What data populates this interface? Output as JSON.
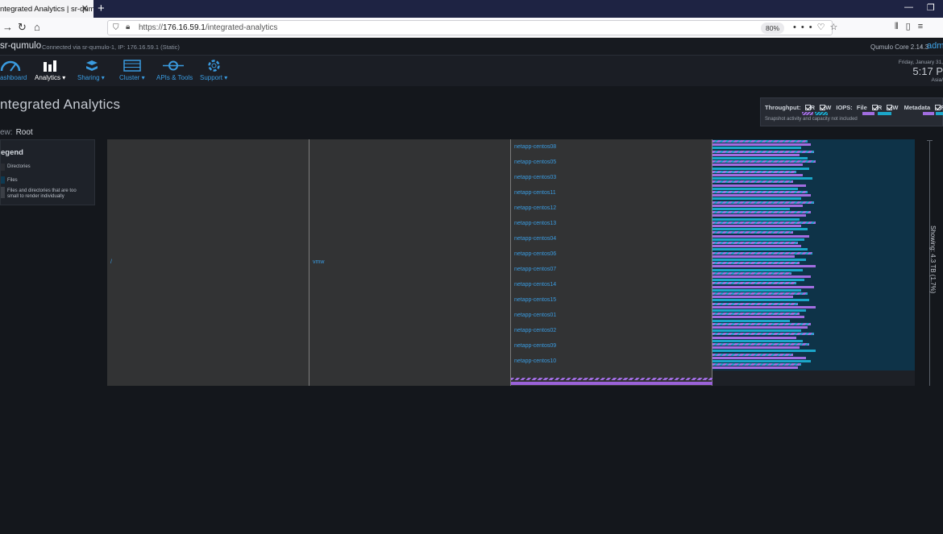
{
  "browser": {
    "tab_title": "ntegrated Analytics | sr-qumul",
    "tab_close": "✕",
    "new_tab": "+",
    "url_prefix": "https://",
    "url_host": "176.16.59.1",
    "url_path": "/integrated-analytics",
    "zoom": "80%"
  },
  "header": {
    "brand": "sr-qumulo",
    "connection": "Connected via sr-qumulo-1, IP: 176.16.59.1 (Static)",
    "core_version": "Qumulo Core 2.14.3",
    "user": "adm",
    "separator": "•"
  },
  "menu": [
    {
      "label": "ashboard",
      "icon": "gauge-icon"
    },
    {
      "label": "Analytics ▾",
      "icon": "bar-chart-icon"
    },
    {
      "label": "Sharing ▾",
      "icon": "share-stack-icon"
    },
    {
      "label": "Cluster ▾",
      "icon": "server-icon"
    },
    {
      "label": "APIs & Tools",
      "icon": "plug-icon"
    },
    {
      "label": "Support ▾",
      "icon": "lifebuoy-icon"
    }
  ],
  "clock": {
    "date": "Friday, January 31,",
    "time": "5:17 P",
    "tz": "Asia/"
  },
  "page": {
    "title": "ntegrated Analytics",
    "view_label": "ew:",
    "view_value": "Root"
  },
  "performance": {
    "throughput_label": "Throughput:",
    "iops_label": "IOPS:",
    "file_label": "File",
    "metadata_label": "Metadata",
    "r": "R",
    "w": "W",
    "note": "Snapshot activity and capacity not included",
    "read_color": "#a16de0",
    "write_color": "#1ba6c9"
  },
  "legend": {
    "title": "egend",
    "items": [
      {
        "label": "Directories",
        "color": "#2a2d33"
      },
      {
        "label": "Files",
        "color": "#0e3a52"
      },
      {
        "label": "Files and directories that are too",
        "label2": "small to render individually",
        "color": "#3b3f46"
      }
    ]
  },
  "treemap": {
    "root_label": "/",
    "vmw_label": "vmw",
    "directories": [
      "netapp-centos08",
      "netapp-centos05",
      "netapp-centos03",
      "netapp-centos11",
      "netapp-centos12",
      "netapp-centos13",
      "netapp-centos04",
      "netapp-centos06",
      "netapp-centos07",
      "netapp-centos14",
      "netapp-centos15",
      "netapp-centos01",
      "netapp-centos02",
      "netapp-centos09",
      "netapp-centos10"
    ]
  },
  "showing": {
    "text": "Showing: 4.3 TB (1.7%)"
  }
}
